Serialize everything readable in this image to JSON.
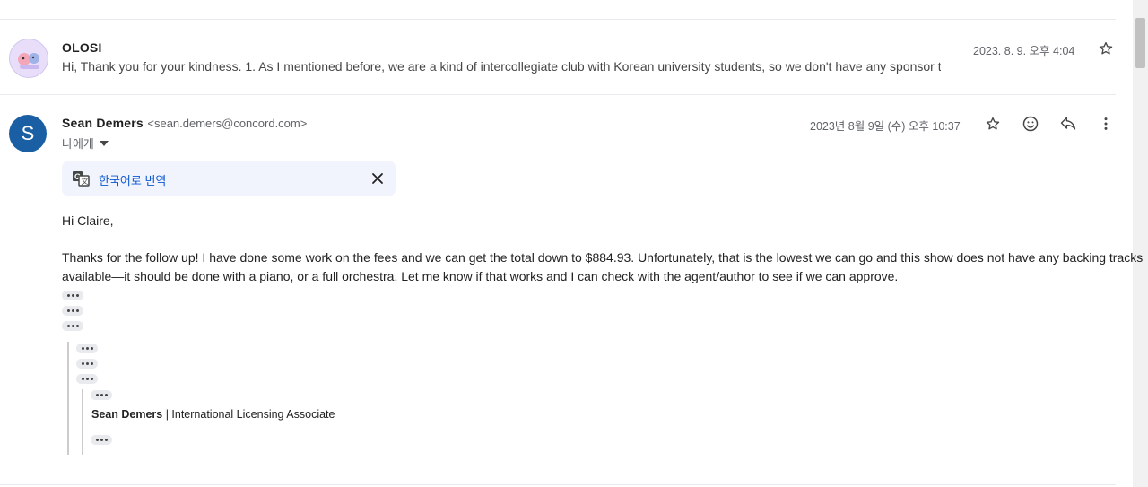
{
  "thread": [
    {
      "sender": "OLOSI",
      "snippet": "Hi, Thank you for your kindness. 1. As I mentioned before, we are a kind of intercollegiate club with Korean university students, so we don't have any sponsor t",
      "date": "2023. 8. 9. 오후 4:04"
    },
    {
      "sender": "Sean Demers",
      "email": "<sean.demers@concord.com>",
      "to": "나에게",
      "date": "2023년 8월 9일 (수) 오후 10:37",
      "translate_label": "한국어로 번역",
      "greeting": "Hi Claire,",
      "body_line1": "Thanks for the follow up! I have done some work on the fees and we can get the total down to $884.93. Unfortunately, that is the lowest we can go and this show does not have any backing tracks",
      "body_line2": "available—it should be done with a piano, or a full orchestra. Let me know if that works and I can check with the agent/author to see if we can approve.",
      "signature_name": "Sean Demers",
      "signature_title": " | International Licensing Associate"
    }
  ],
  "icons": [
    "star-icon",
    "emoji-icon",
    "reply-icon",
    "more-vert-icon",
    "translate-icon",
    "close-icon",
    "dropdown-arrow-icon",
    "ellipsis-icon"
  ],
  "colors": {
    "avatar_s": "#1a5fa3",
    "translate_bg": "#f1f4fc",
    "link_blue": "#0b57d0"
  }
}
